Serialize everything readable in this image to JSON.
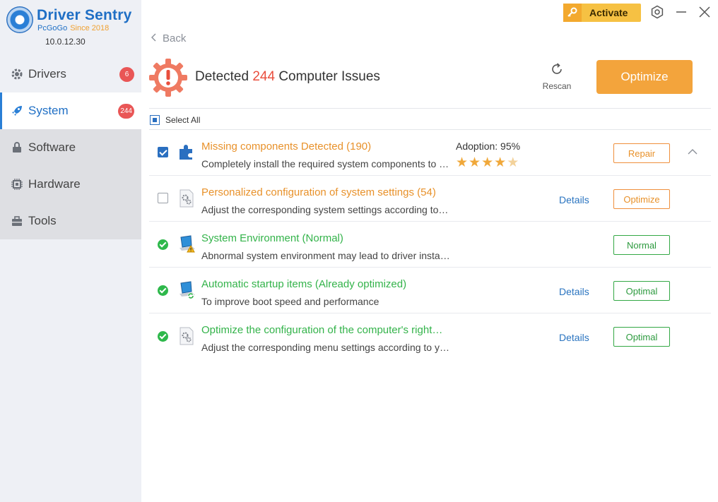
{
  "app": {
    "brand_title": "Driver Sentry",
    "brand_sub": "PcGoGo",
    "brand_since": "Since 2018",
    "version": "10.0.12.30"
  },
  "sidebar": {
    "items": [
      {
        "label": "Drivers",
        "icon": "gear-icon",
        "badge": "6"
      },
      {
        "label": "System",
        "icon": "rocket-icon",
        "badge": "244"
      },
      {
        "label": "Software",
        "icon": "lock-icon"
      },
      {
        "label": "Hardware",
        "icon": "chip-icon"
      },
      {
        "label": "Tools",
        "icon": "toolbox-icon"
      }
    ]
  },
  "topbar": {
    "activate_label": "Activate"
  },
  "nav": {
    "back_label": "Back"
  },
  "header": {
    "detected_prefix": "Detected",
    "issue_count": "244",
    "detected_suffix": "Computer Issues",
    "rescan_label": "Rescan",
    "optimize_label": "Optimize"
  },
  "select_all": {
    "label": "Select All"
  },
  "rows": [
    {
      "title": "Missing components Detected (190)",
      "desc": "Completely install the required system components to ensure software running",
      "adoption": "Adoption: 95%",
      "rating": 4.5,
      "action": "Repair",
      "status": "issue"
    },
    {
      "title": "Personalized configuration of system settings (54)",
      "desc": "Adjust the corresponding system settings according to your habits",
      "details": "Details",
      "action": "Optimize",
      "status": "issue"
    },
    {
      "title": "System Environment (Normal)",
      "desc": "Abnormal system environment may lead to driver installation failure",
      "action": "Normal",
      "status": "ok"
    },
    {
      "title": "Automatic startup items (Already optimized)",
      "desc": "To improve boot speed and performance",
      "details": "Details",
      "action": "Optimal",
      "status": "ok"
    },
    {
      "title": "Optimize the configuration of the computer's right…",
      "desc": "Adjust the corresponding menu settings according to your habits",
      "details": "Details",
      "action": "Optimal",
      "status": "ok"
    }
  ],
  "colors": {
    "accent_blue": "#2a6fc0",
    "warning_orange": "#e8912a",
    "ok_green": "#33b34a",
    "optimize_button": "#f3a43c",
    "badge_red": "#e95656"
  }
}
